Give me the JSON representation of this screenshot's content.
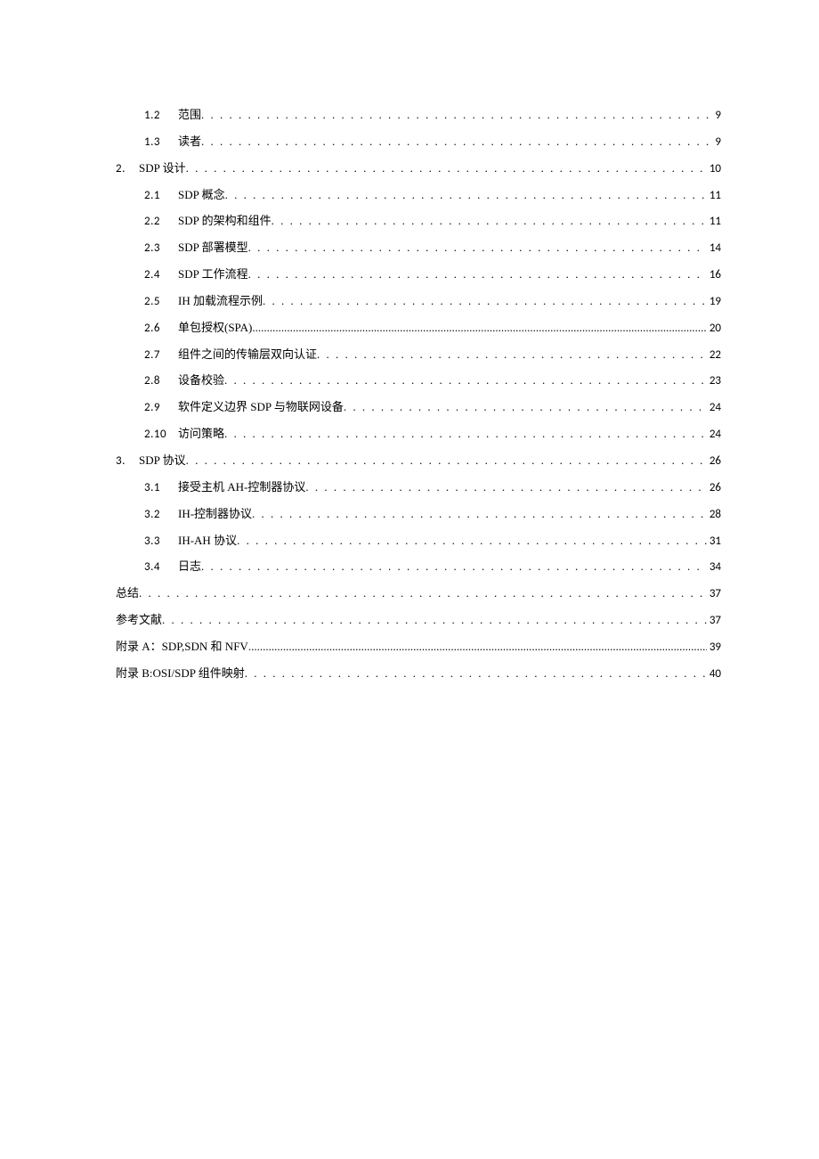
{
  "toc": [
    {
      "level": 2,
      "num": "1.2",
      "title": "范围",
      "page": "9",
      "dense": false
    },
    {
      "level": 2,
      "num": "1.3",
      "title": "读者",
      "page": "9",
      "dense": false
    },
    {
      "level": 1,
      "num": "2.",
      "title": "SDP 设计",
      "page": "10",
      "dense": false
    },
    {
      "level": 2,
      "num": "2.1",
      "title": "SDP 概念",
      "page": "11",
      "dense": false
    },
    {
      "level": 2,
      "num": "2.2",
      "title": "SDP 的架构和组件",
      "page": "11",
      "dense": false
    },
    {
      "level": 2,
      "num": "2.3",
      "title": "SDP 部署模型",
      "page": "14",
      "dense": false
    },
    {
      "level": 2,
      "num": "2.4",
      "title": "SDP 工作流程",
      "page": "16",
      "dense": false
    },
    {
      "level": 2,
      "num": "2.5",
      "title": "IH 加载流程示例",
      "page": "19",
      "dense": false
    },
    {
      "level": 2,
      "num": "2.6",
      "title": "单包授权(SPA)",
      "page": "20",
      "dense": true
    },
    {
      "level": 2,
      "num": "2.7",
      "title": "组件之间的传输层双向认证",
      "page": "22",
      "dense": false
    },
    {
      "level": 2,
      "num": "2.8",
      "title": "设备校验",
      "page": "23",
      "dense": false
    },
    {
      "level": 2,
      "num": "2.9",
      "title": "软件定义边界 SDP 与物联网设备",
      "page": "24",
      "dense": false
    },
    {
      "level": 2,
      "num": "2.10",
      "title": "访问策略",
      "page": "24",
      "dense": false
    },
    {
      "level": 1,
      "num": "3.",
      "title": "SDP 协议",
      "page": "26",
      "dense": false
    },
    {
      "level": 2,
      "num": "3.1",
      "title": "接受主机 AH-控制器协议",
      "page": "26",
      "dense": false
    },
    {
      "level": 2,
      "num": "3.2",
      "title": "IH-控制器协议",
      "page": "28",
      "dense": false
    },
    {
      "level": 2,
      "num": "3.3",
      "title": "IH-AH 协议",
      "page": "31",
      "dense": false
    },
    {
      "level": 2,
      "num": "3.4",
      "title": "日志",
      "page": "34",
      "dense": false
    },
    {
      "level": 0,
      "num": "",
      "title": "总结",
      "page": "37",
      "dense": false
    },
    {
      "level": 0,
      "num": "",
      "title": "参考文献",
      "page": "37",
      "dense": false
    },
    {
      "level": 0,
      "num": "",
      "title": "附录 A：SDP,SDN 和 NFV",
      "page": "39",
      "dense": true
    },
    {
      "level": 0,
      "num": "",
      "title": "附录 B:OSI/SDP 组件映射",
      "page": "40",
      "dense": false
    }
  ]
}
